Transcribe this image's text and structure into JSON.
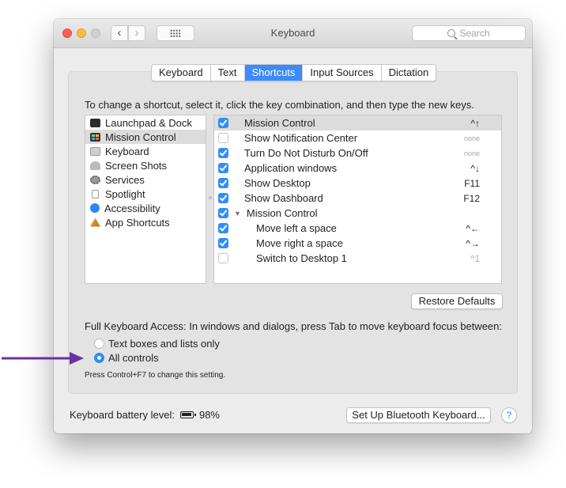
{
  "window": {
    "title": "Keyboard",
    "search_placeholder": "Search",
    "nav_back": "‹",
    "nav_forward": "›"
  },
  "tabs": [
    {
      "label": "Keyboard",
      "active": false
    },
    {
      "label": "Text",
      "active": false
    },
    {
      "label": "Shortcuts",
      "active": true
    },
    {
      "label": "Input Sources",
      "active": false
    },
    {
      "label": "Dictation",
      "active": false
    }
  ],
  "instruction": "To change a shortcut, select it, click the key combination, and then type the new keys.",
  "categories": [
    {
      "label": "Launchpad & Dock",
      "icon": "launchpad-icon",
      "selected": false
    },
    {
      "label": "Mission Control",
      "icon": "mission-control-icon",
      "selected": true
    },
    {
      "label": "Keyboard",
      "icon": "keyboard-icon",
      "selected": false
    },
    {
      "label": "Screen Shots",
      "icon": "screenshot-icon",
      "selected": false
    },
    {
      "label": "Services",
      "icon": "gear-icon",
      "selected": false
    },
    {
      "label": "Spotlight",
      "icon": "spotlight-icon",
      "selected": false
    },
    {
      "label": "Accessibility",
      "icon": "accessibility-icon",
      "selected": false
    },
    {
      "label": "App Shortcuts",
      "icon": "app-shortcuts-icon",
      "selected": false
    }
  ],
  "shortcuts": [
    {
      "label": "Mission Control",
      "key": "^↑",
      "checked": true
    },
    {
      "label": "Show Notification Center",
      "key": "none",
      "checked": false
    },
    {
      "label": "Turn Do Not Disturb On/Off",
      "key": "none",
      "checked": true
    },
    {
      "label": "Application windows",
      "key": "^↓",
      "checked": true
    },
    {
      "label": "Show Desktop",
      "key": "F11",
      "checked": true
    },
    {
      "label": "Show Dashboard",
      "key": "F12",
      "checked": true
    },
    {
      "label": "Mission Control",
      "key": "",
      "checked": true,
      "group": true,
      "disclosure": "▼"
    },
    {
      "label": "Move left a space",
      "key": "^←",
      "checked": true
    },
    {
      "label": "Move right a space",
      "key": "^→",
      "checked": true
    },
    {
      "label": "Switch to Desktop 1",
      "key": "^1",
      "checked": false
    }
  ],
  "restore_defaults": "Restore Defaults",
  "full_keyboard_access": "Full Keyboard Access: In windows and dialogs, press Tab to move keyboard focus between:",
  "radio_options": [
    {
      "label": "Text boxes and lists only",
      "selected": false
    },
    {
      "label": "All controls",
      "selected": true
    }
  ],
  "hint": "Press Control+F7 to change this setting.",
  "battery": {
    "label": "Keyboard battery level:",
    "value": "98%"
  },
  "bluetooth_button": "Set Up Bluetooth Keyboard...",
  "help_button": "?",
  "colors": {
    "accent": "#2f8dfb",
    "annotation_arrow": "#6b2fa3"
  }
}
